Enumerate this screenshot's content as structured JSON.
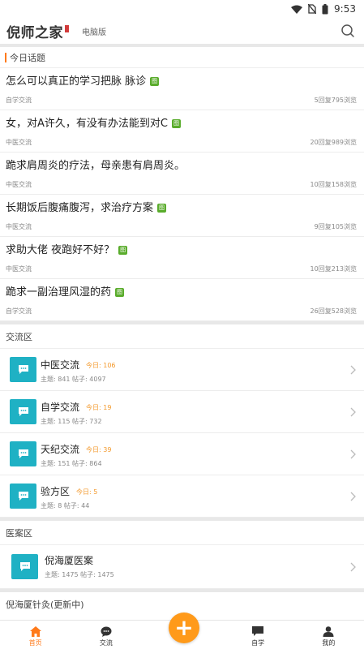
{
  "status_bar": {
    "time": "9:53"
  },
  "header": {
    "title": "倪师之家",
    "desktop_link": "电脑版"
  },
  "today": {
    "heading": "今日话题",
    "topics": [
      {
        "title": "怎么可以真正的学习把脉 脉诊",
        "has_pic": true,
        "category": "自学交流",
        "stats": "5回复795浏览"
      },
      {
        "title": "女，对A许久，有没有办法能到对C",
        "has_pic": true,
        "category": "中医交流",
        "stats": "20回复989浏览"
      },
      {
        "title": "跪求肩周炎的疗法，母亲患有肩周炎。",
        "has_pic": false,
        "category": "中医交流",
        "stats": "10回复158浏览"
      },
      {
        "title": "长期饭后腹痛腹泻，求治疗方案",
        "has_pic": true,
        "category": "中医交流",
        "stats": "9回复105浏览"
      },
      {
        "title": "求助大佬 夜跑好不好？",
        "has_pic": true,
        "category": "中医交流",
        "stats": "10回复213浏览"
      },
      {
        "title": "跪求一副治理风湿的药",
        "has_pic": true,
        "category": "自学交流",
        "stats": "26回复528浏览"
      }
    ],
    "pic_badge": "图"
  },
  "exchange": {
    "heading": "交流区",
    "forums": [
      {
        "name": "中医交流",
        "today": "今日: 106",
        "stats": "主题: 841  帖子: 4097"
      },
      {
        "name": "自学交流",
        "today": "今日: 19",
        "stats": "主题: 115  帖子: 732"
      },
      {
        "name": "天纪交流",
        "today": "今日: 39",
        "stats": "主题: 151  帖子: 864"
      },
      {
        "name": "验方区",
        "today": "今日: 5",
        "stats": "主题: 8  帖子: 44"
      }
    ]
  },
  "cases": {
    "heading": "医案区",
    "forums": [
      {
        "name": "倪海厦医案",
        "stats": "主题: 1475  帖子: 1475"
      }
    ]
  },
  "acupuncture": {
    "heading": "倪海厦针灸(更新中)"
  },
  "tabs": [
    {
      "label": "首页",
      "icon": "home-icon",
      "active": true
    },
    {
      "label": "交流",
      "icon": "chat-bubble-icon",
      "active": false
    },
    {
      "label": "自学",
      "icon": "chat-square-icon",
      "active": false
    },
    {
      "label": "我的",
      "icon": "person-icon",
      "active": false
    }
  ],
  "fab_label": "+",
  "colors": {
    "accent": "#ff7a1a",
    "forum_icon": "#1fb1c4",
    "pic_badge": "#5aac2c",
    "today_count": "#f39a2e"
  }
}
